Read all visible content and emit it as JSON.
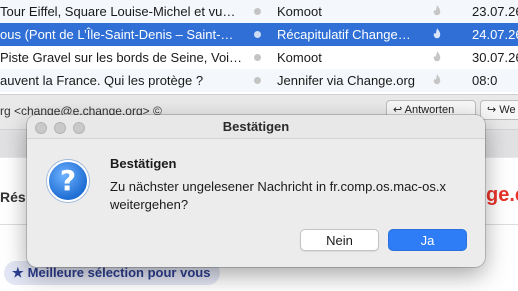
{
  "message_list": {
    "rows": [
      {
        "subject": "Tour Eiffel, Square Louise-Michel et vu…",
        "from": "Komoot",
        "date": "23.07.26"
      },
      {
        "subject": "ous (Pont de L’Île-Saint-Denis – Saint-…",
        "from": "Récapitulatif Change…",
        "date": "24.07.26"
      },
      {
        "subject": "Piste Gravel sur les bords de Seine, Voi…",
        "from": "Komoot",
        "date": "30.07.26"
      },
      {
        "subject": "auvent la France. Qui les protège ?",
        "from": "Jennifer via Change.org",
        "date": "08:0"
      }
    ]
  },
  "header": {
    "from_line": "rg <change@e.change.org> ©",
    "reply_label": "Antworten",
    "forward_label": "We"
  },
  "body": {
    "section_label": "Rés",
    "brand_fragment": "ge.c",
    "best_selection": "Meilleure sélection pour vous"
  },
  "dialog": {
    "title": "Bestätigen",
    "heading": "Bestätigen",
    "message": "Zu nächster ungelesener Nachricht in fr.comp.os.mac-os.x weitergehen?",
    "no_label": "Nein",
    "yes_label": "Ja",
    "icon": "question-icon",
    "accent_color": "#2f7df6"
  }
}
